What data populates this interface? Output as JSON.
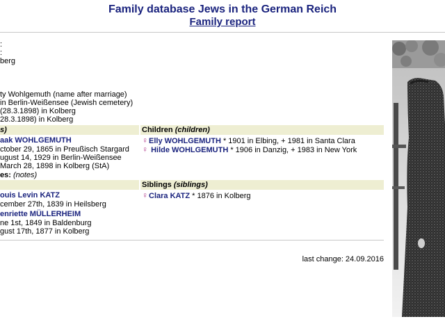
{
  "header": {
    "site_title": "Family database Jews in the German Reich",
    "page_title": "Family report"
  },
  "person": {
    "line1": ":",
    "line2": ":",
    "line3": "berg",
    "married_name": "ty Wohlgemuth (name after marriage)",
    "burial": "in Berlin-Weißensee (Jewish cemetery)",
    "marriage1": " (28.3.1898) in Kolberg",
    "marriage2": "28.3.1898) in Kolberg"
  },
  "spouse_section": {
    "header_tail": "s)",
    "name": "aak WOHLGEMUTH",
    "born": "ctober 29, 1865 in Preußisch Stargard",
    "died": "ugust 14, 1929 in Berlin-Weißensee",
    "married": "March 28, 1898 in Kolberg (StA)",
    "notes_label": "es:",
    "notes_value": "(notes)"
  },
  "children_section": {
    "header_label": "Children",
    "header_sub": "(children)",
    "items": [
      {
        "icon": "♀",
        "name": "Elly WOHLGEMUTH",
        "details": " * 1901 in Elbing, + 1981 in Santa Clara"
      },
      {
        "icon": "♀",
        "name": "Hilde WOHLGEMUTH",
        "details": " * 1906 in Danzig, + 1983 in New York"
      }
    ]
  },
  "parents_section": {
    "header_tail": "",
    "father_name": "ouis Levin KATZ",
    "father_born": "cember 27th, 1839 in Heilsberg",
    "mother_name": "enriette MÜLLERHEIM",
    "mother_born": "ne 1st, 1849 in Baldenburg",
    "mother_died": "gust 17th, 1877 in Kolberg"
  },
  "siblings_section": {
    "header_label": "Siblings",
    "header_sub": "(siblings)",
    "items": [
      {
        "icon": "♀",
        "name": "Clara KATZ",
        "details": " * 1876 in Kolberg"
      }
    ]
  },
  "footer": {
    "last_change": "last change: 24.09.2016"
  },
  "colors": {
    "title": "#1a237e",
    "link": "#1a237e",
    "band": "#eeeed2",
    "female_icon": "#b23c8c"
  }
}
